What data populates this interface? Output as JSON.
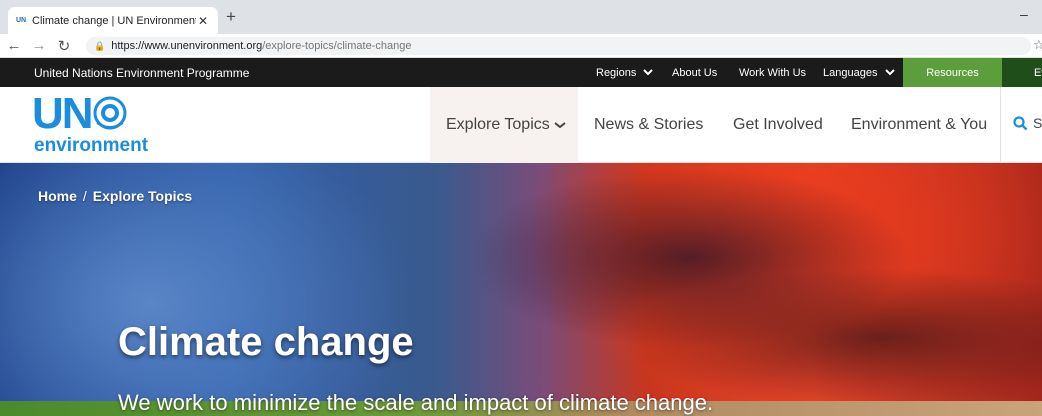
{
  "browser": {
    "tab_title": "Climate change | UN Environment",
    "tab_favicon": "UN",
    "url_host": "https://www.unenvironment.org",
    "url_path": "/explore-topics/climate-change",
    "icons": [
      "back-icon",
      "forward-icon",
      "reload-icon",
      "lock-icon",
      "star-icon",
      "close-icon",
      "new-tab-icon",
      "minimize-icon"
    ]
  },
  "utility_bar": {
    "org_name": "United Nations Environment Programme",
    "regions": "Regions",
    "about": "About Us",
    "work": "Work With Us",
    "languages": "Languages",
    "resources": "Resources",
    "cut": "Ev",
    "resources_color": "#5c9e3c"
  },
  "header": {
    "logo_un": "UN",
    "logo_env": "environment",
    "nav": [
      "Explore Topics",
      "News & Stories",
      "Get Involved",
      "Environment & You"
    ],
    "search_label": "S",
    "brand_color": "#1b8de0"
  },
  "hero": {
    "breadcrumb_home": "Home",
    "breadcrumb_sep": "/",
    "breadcrumb_current": "Explore Topics",
    "title": "Climate change",
    "subtitle": "We work to minimize the scale and impact of climate change."
  }
}
